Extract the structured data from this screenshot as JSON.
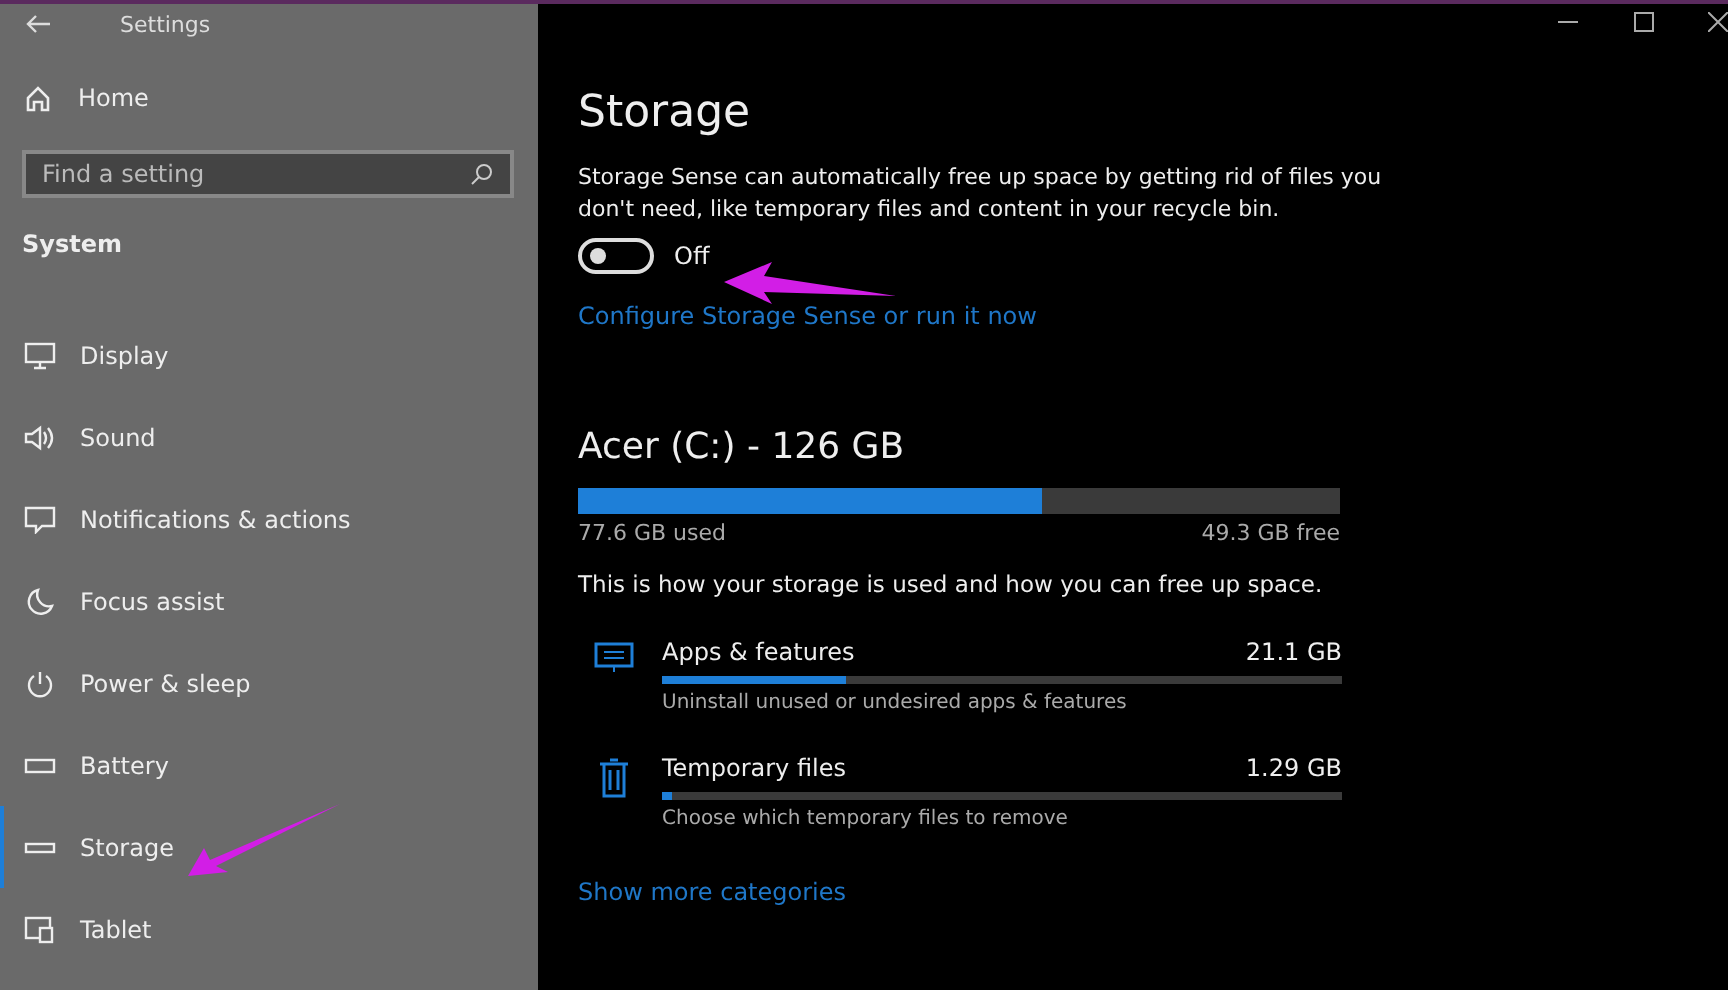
{
  "window": {
    "title": "Settings"
  },
  "sidebar": {
    "home": "Home",
    "search": {
      "placeholder": "Find a setting"
    },
    "section": "System",
    "items": [
      {
        "label": "Display",
        "kind": "display",
        "selected": false
      },
      {
        "label": "Sound",
        "kind": "sound",
        "selected": false
      },
      {
        "label": "Notifications & actions",
        "kind": "notifications",
        "selected": false
      },
      {
        "label": "Focus assist",
        "kind": "moon",
        "selected": false
      },
      {
        "label": "Power & sleep",
        "kind": "power",
        "selected": false
      },
      {
        "label": "Battery",
        "kind": "battery",
        "selected": false
      },
      {
        "label": "Storage",
        "kind": "storage",
        "selected": true
      },
      {
        "label": "Tablet",
        "kind": "tablet",
        "selected": false
      }
    ]
  },
  "page": {
    "title": "Storage",
    "description": "Storage Sense can automatically free up space by getting rid of files you don't need, like temporary files and content in your recycle bin.",
    "toggle": {
      "on": false,
      "label": "Off"
    },
    "link": "Configure Storage Sense or run it now",
    "drive": {
      "title": "Acer (C:) - 126 GB",
      "level": 0.61,
      "used": "77.6 GB used",
      "free": "49.3 GB free"
    },
    "usage_note": "This is how your storage is used and how you can free up space.",
    "categories": [
      {
        "kind": "apps",
        "name": "Apps & features",
        "size": "21.1 GB",
        "level": 0.27,
        "hint": "Uninstall unused or undesired apps & features"
      },
      {
        "kind": "temp",
        "name": "Temporary files",
        "size": "1.29 GB",
        "level": 0.015,
        "hint": "Choose which temporary files to remove"
      }
    ],
    "more_link": "Show more categories"
  }
}
